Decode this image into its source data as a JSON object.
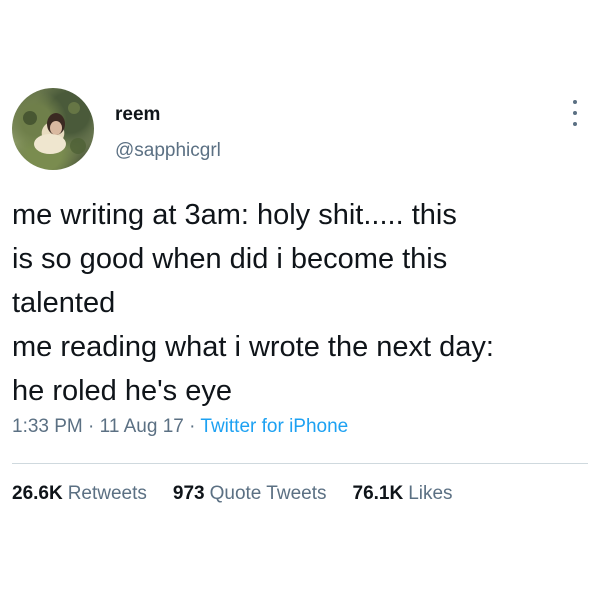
{
  "user": {
    "display_name": "reem",
    "handle": "@sapphicgrl",
    "avatar_icon": "profile-photo"
  },
  "tweet": {
    "lines": [
      "me writing at 3am: holy shit..... this",
      "is so good when did i become this",
      "talented",
      "me reading what i wrote the next day:",
      "he roled he's eye"
    ],
    "time": "1:33 PM",
    "date": "11 Aug 17",
    "source": "Twitter for iPhone",
    "separator": "·"
  },
  "stats": {
    "retweets_count": "26.6K",
    "retweets_label": "Retweets",
    "quotes_count": "973",
    "quotes_label": "Quote Tweets",
    "likes_count": "76.1K",
    "likes_label": "Likes"
  },
  "colors": {
    "text": "#0f1419",
    "secondary": "#5b7083",
    "link": "#1da1f2",
    "divider": "#cfd9de"
  }
}
